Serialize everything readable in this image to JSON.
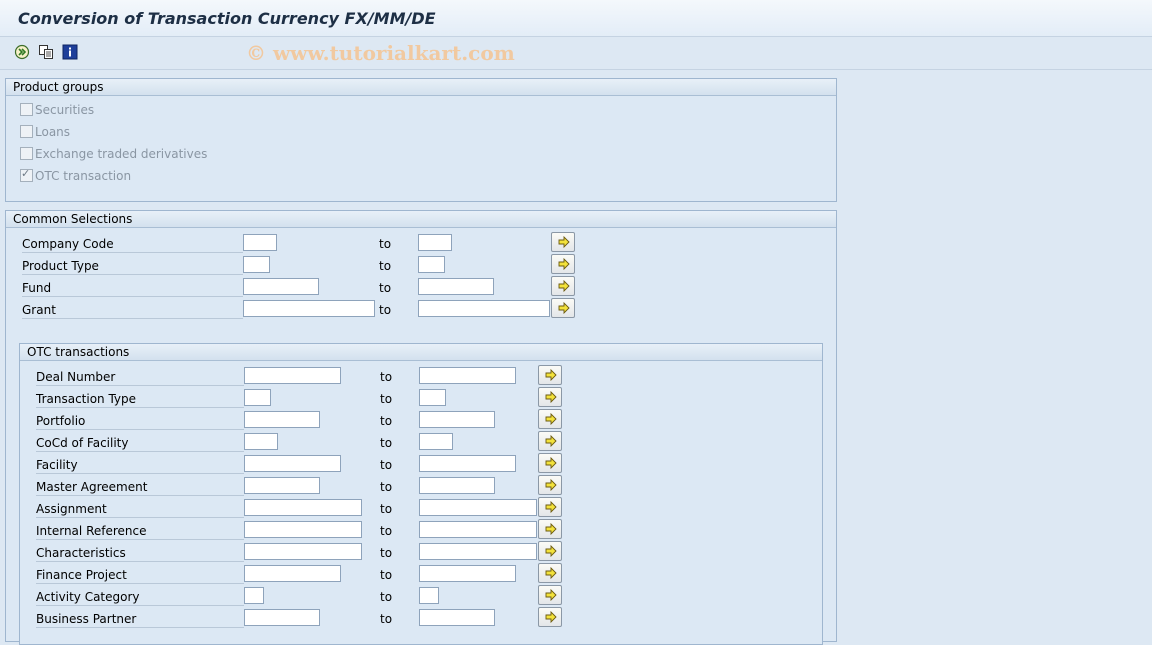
{
  "window": {
    "title": "Conversion of Transaction Currency FX/MM/DE"
  },
  "toolbar": {
    "icons": [
      "execute-icon",
      "variant-icon",
      "info-icon"
    ],
    "watermark": "© www.tutorialkart.com"
  },
  "product_groups": {
    "header": "Product groups",
    "items": [
      {
        "label": "Securities",
        "checked": false
      },
      {
        "label": "Loans",
        "checked": false
      },
      {
        "label": "Exchange traded derivatives",
        "checked": false
      },
      {
        "label": "OTC transaction",
        "checked": true
      }
    ]
  },
  "common_selections": {
    "header": "Common Selections",
    "to_label": "to",
    "rows": [
      {
        "label": "Company Code",
        "from": "",
        "to": ""
      },
      {
        "label": "Product Type",
        "from": "",
        "to": ""
      },
      {
        "label": "Fund",
        "from": "",
        "to": ""
      },
      {
        "label": "Grant",
        "from": "",
        "to": ""
      }
    ]
  },
  "otc_transactions": {
    "header": "OTC transactions",
    "to_label": "to",
    "rows": [
      {
        "label": "Deal Number",
        "from": "",
        "to": ""
      },
      {
        "label": "Transaction Type",
        "from": "",
        "to": ""
      },
      {
        "label": "Portfolio",
        "from": "",
        "to": ""
      },
      {
        "label": "CoCd of Facility",
        "from": "",
        "to": ""
      },
      {
        "label": "Facility",
        "from": "",
        "to": ""
      },
      {
        "label": "Master Agreement",
        "from": "",
        "to": ""
      },
      {
        "label": "Assignment",
        "from": "",
        "to": ""
      },
      {
        "label": "Internal Reference",
        "from": "",
        "to": ""
      },
      {
        "label": "Characteristics",
        "from": "",
        "to": ""
      },
      {
        "label": "Finance Project",
        "from": "",
        "to": ""
      },
      {
        "label": "Activity Category",
        "from": "",
        "to": ""
      },
      {
        "label": "Business Partner",
        "from": "",
        "to": ""
      }
    ]
  }
}
